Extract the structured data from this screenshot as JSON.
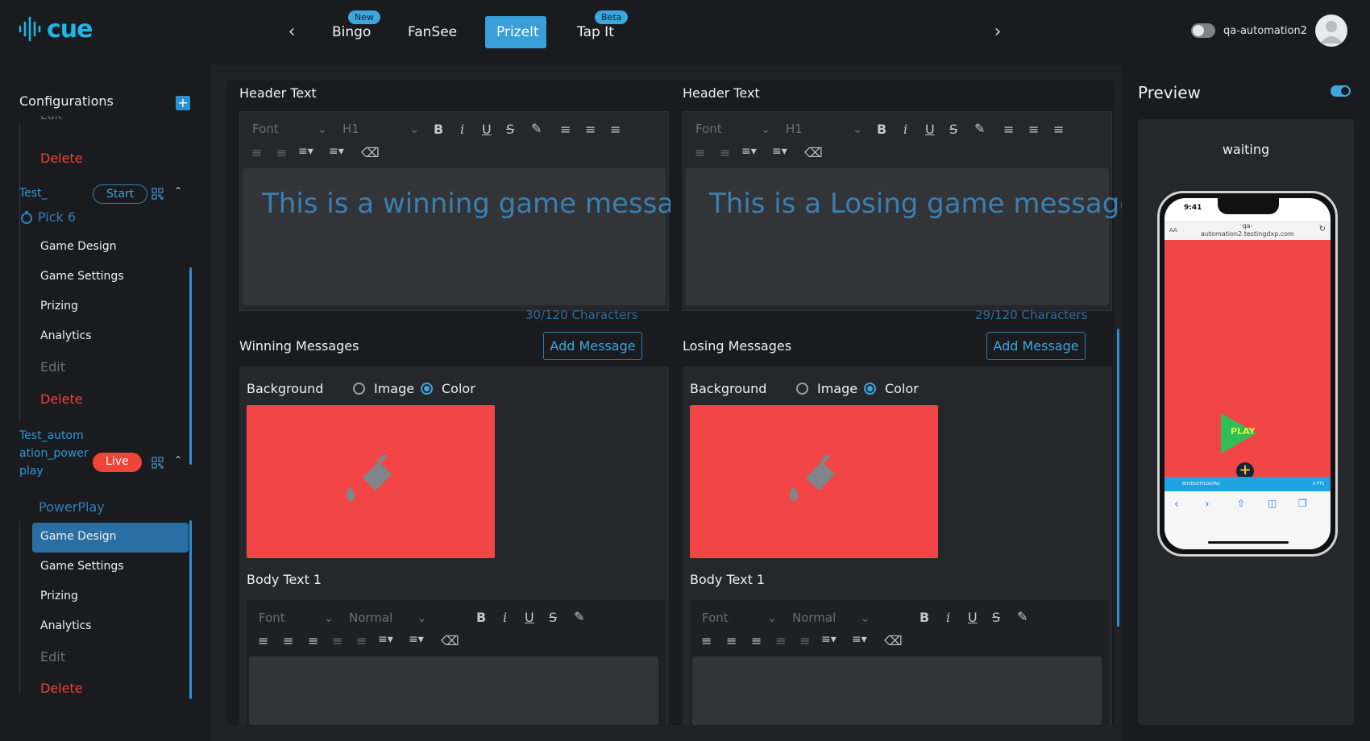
{
  "app": {
    "logo_text": "cue",
    "brand_color": "#1fb6e8",
    "accent_color": "#3a9ed8"
  },
  "topnav": {
    "tabs": [
      {
        "label": "Bingo",
        "badge": "New"
      },
      {
        "label": "FanSee",
        "badge": ""
      },
      {
        "label": "PrizeIt",
        "badge": "",
        "active": true
      },
      {
        "label": "Tap It",
        "badge": "Beta"
      }
    ],
    "username": "qa-automation2"
  },
  "sidebar": {
    "title": "Configurations",
    "add_icon": "plus-square-icon",
    "clipped_edit": "Edit",
    "delete_label_1": "Delete",
    "campaign_1": {
      "name": "Test_",
      "status": "Start",
      "game_name": "Pick 6",
      "items": [
        "Game Design",
        "Game Settings",
        "Prizing",
        "Analytics"
      ],
      "edit": "Edit",
      "delete": "Delete"
    },
    "campaign_2": {
      "name_line1": "Test_autom",
      "name_line2": "ation_power",
      "name_line3": "play",
      "status": "Live",
      "game_name": "PowerPlay",
      "items": [
        "Game Design",
        "Game Settings",
        "Prizing",
        "Analytics"
      ],
      "active_item": "Game Design",
      "edit": "Edit",
      "delete": "Delete"
    }
  },
  "editor_left": {
    "header_label": "Header Text",
    "font_placeholder": "Font",
    "heading_select": "H1",
    "message": "This is a winning game message",
    "char_count": "30/120 Characters",
    "section_label": "Winning Messages",
    "add_message": "Add Message",
    "background_label": "Background",
    "radio_image": "Image",
    "radio_color": "Color",
    "selected_background": "Color",
    "swatch_color": "#f24646",
    "body_label": "Body Text 1",
    "body_font": "Font",
    "body_size": "Normal"
  },
  "editor_right": {
    "header_label": "Header Text",
    "font_placeholder": "Font",
    "heading_select": "H1",
    "message": "This is a Losing game message",
    "char_count": "29/120 Characters",
    "section_label": "Losing Messages",
    "add_message": "Add Message",
    "background_label": "Background",
    "radio_image": "Image",
    "radio_color": "Color",
    "selected_background": "Color",
    "swatch_color": "#f24646",
    "body_label": "Body Text 1",
    "body_font": "Font",
    "body_size": "Normal"
  },
  "preview": {
    "title": "Preview",
    "toggle_on": true,
    "status": "waiting",
    "phone_time": "9:41",
    "url_line1": "qa-",
    "url_line2": "automation2.testingdxp.com",
    "aa_label": "AA",
    "play_label": "PLAY",
    "strip_left": "BOVEGSTPLOGTAG",
    "strip_right": "0 PTS"
  }
}
